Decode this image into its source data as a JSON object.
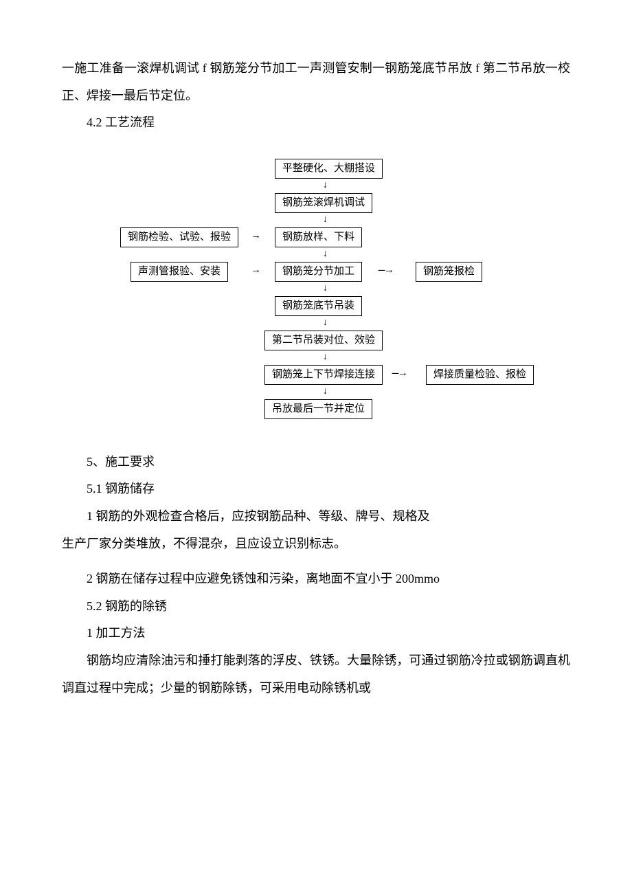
{
  "para1": "一施工准备一滚焊机调试 f 钢筋笼分节加工一声测管安制一钢筋笼底节吊放 f 第二节吊放一校正、焊接一最后节定位。",
  "sec42": "4.2  工艺流程",
  "flow": {
    "n1": "平整硬化、大棚搭设",
    "n2": "钢筋笼滚焊机调试",
    "n3_left": "钢筋检验、试验、报验",
    "n3": "钢筋放样、下料",
    "n4_left": "声测管报验、安装",
    "n4": "钢筋笼分节加工",
    "n4_right": "钢筋笼报检",
    "n5": "钢筋笼底节吊装",
    "n6": "第二节吊装对位、效验",
    "n7": "钢筋笼上下节焊接连接",
    "n7_right": "焊接质量检验、报检",
    "n8": "吊放最后一节并定位"
  },
  "sec5": "5、施工要求",
  "sec51": "5.1  钢筋储存",
  "p511a": "1 钢筋的外观检查合格后，应按钢筋品种、等级、牌号、规格及",
  "p511b": "生产厂家分类堆放，不得混杂，且应设立识别标志。",
  "p512": "2 钢筋在储存过程中应避免锈蚀和污染，离地面不宜小于 200mmo",
  "sec52": "5.2   钢筋的除锈",
  "p521": "1 加工方法",
  "p522a": "钢筋均应清除油污和捶打能剥落的浮皮、铁锈。大量除锈，可通过钢筋冷拉或钢筋调直机调直过程中完成；少量的钢筋除锈，可采用电动除锈机或"
}
